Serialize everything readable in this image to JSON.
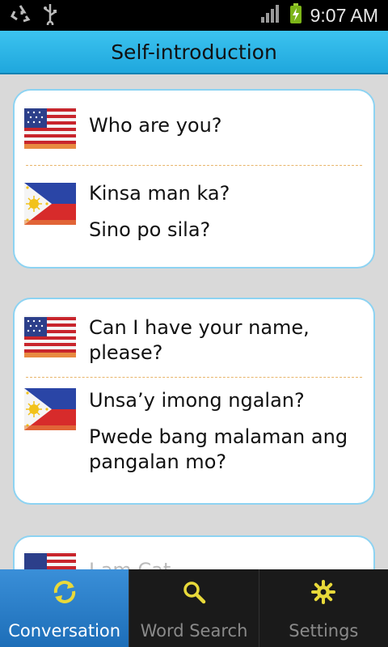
{
  "status": {
    "time": "9:07 AM"
  },
  "header": {
    "title": "Self-introduction"
  },
  "cards": [
    {
      "english": [
        "Who are you?"
      ],
      "filipino": [
        "Kinsa man ka?",
        "Sino po sila?"
      ]
    },
    {
      "english": [
        "Can I have your name, please?"
      ],
      "filipino": [
        "Unsa’y imong ngalan?",
        "Pwede bang malaman ang pangalan mo?"
      ]
    },
    {
      "english": [
        "I am Cat."
      ],
      "filipino": []
    }
  ],
  "tabs": [
    {
      "label": "Conversation",
      "icon": "refresh-arrows-icon",
      "active": true
    },
    {
      "label": "Word Search",
      "icon": "search-icon",
      "active": false
    },
    {
      "label": "Settings",
      "icon": "gear-icon",
      "active": false
    }
  ],
  "colors": {
    "accent": "#1fa7dd",
    "tab_active": "#2a7fc8",
    "icon_yellow": "#e8d93a",
    "card_border": "#8dd3f2"
  }
}
